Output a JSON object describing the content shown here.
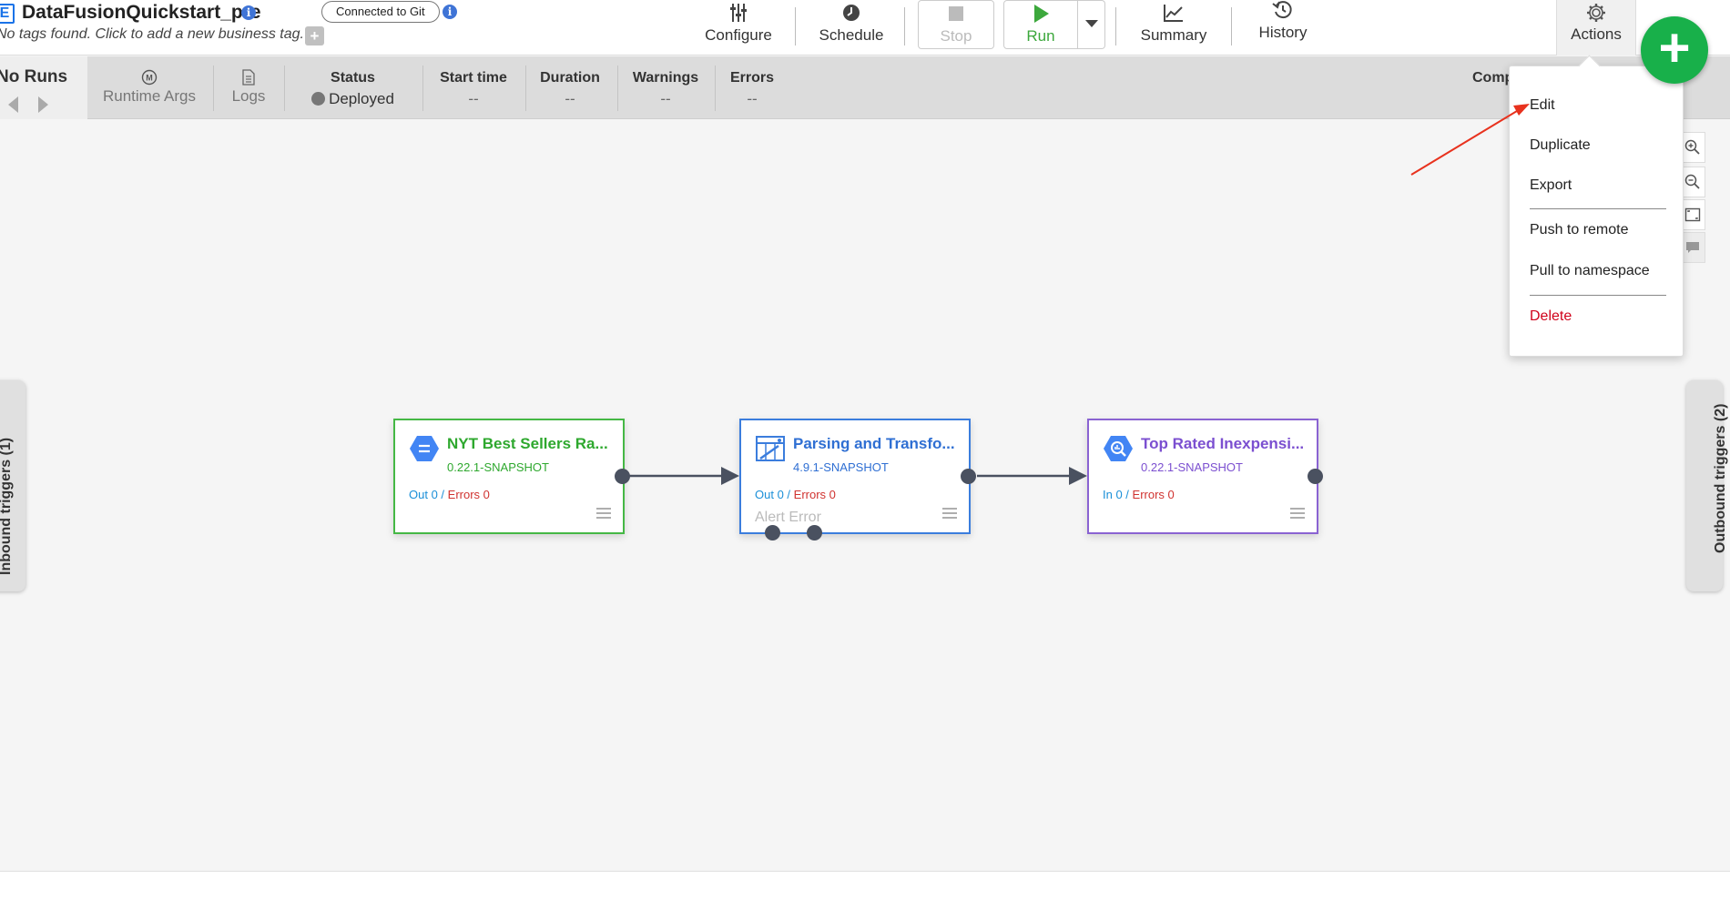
{
  "header": {
    "pipeline_name": "DataFusionQuickstart_pre",
    "app_icon_letter": "E",
    "tags_text": "No tags found. Click to add a new business tag.",
    "add_tag_label": "+",
    "git_badge": "Connected to Git",
    "info_glyph": "i"
  },
  "toolbar": {
    "configure": "Configure",
    "schedule": "Schedule",
    "stop": "Stop",
    "run": "Run",
    "summary": "Summary",
    "history": "History",
    "actions": "Actions",
    "fab_label": "+"
  },
  "run_bar": {
    "no_runs": "No Runs",
    "runtime_args": "Runtime Args",
    "runtime_args_icon": "M",
    "logs": "Logs",
    "status_header": "Status",
    "status_value": "Deployed",
    "start_time_header": "Start time",
    "start_time_value": "--",
    "duration_header": "Duration",
    "duration_value": "--",
    "warnings_header": "Warnings",
    "warnings_value": "--",
    "errors_header": "Errors",
    "errors_value": "--",
    "compute_partial": "Comp"
  },
  "triggers": {
    "inbound": "Inbound triggers (1)",
    "outbound": "Outbound triggers (2)"
  },
  "nodes": [
    {
      "title": "NYT Best Sellers Ra...",
      "version": "0.22.1-SNAPSHOT",
      "metric_label": "Out 0 /",
      "errors_label": "Errors 0",
      "color": "#45b845"
    },
    {
      "title": "Parsing and Transfo...",
      "version": "4.9.1-SNAPSHOT",
      "metric_label": "Out 0 /",
      "errors_label": "Errors 0",
      "extra": "Alert   Error",
      "color": "#3b7ddd"
    },
    {
      "title": "Top Rated Inexpensi...",
      "version": "0.22.1-SNAPSHOT",
      "metric_label": "In 0 /",
      "errors_label": "Errors 0",
      "color": "#8a63d2"
    }
  ],
  "actions_menu": {
    "edit": "Edit",
    "duplicate": "Duplicate",
    "export": "Export",
    "push_to_remote": "Push to remote",
    "pull_to_namespace": "Pull to namespace",
    "delete": "Delete"
  },
  "colors": {
    "accent_blue": "#1a73e8",
    "run_green": "#3ca83c",
    "fab_green": "#18b04a",
    "delete_red": "#d0021b",
    "annotation_red": "#e8321e"
  },
  "icons": {
    "configure": "sliders-icon",
    "schedule": "clock-icon",
    "stop": "stop-square-icon",
    "run": "play-icon",
    "summary": "line-chart-icon",
    "history": "history-icon",
    "actions": "gear-icon"
  }
}
